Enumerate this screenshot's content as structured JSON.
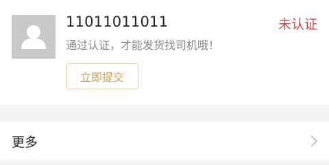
{
  "profile": {
    "phone": "11011011011",
    "hint": "通过认证，才能发货找司机哦！",
    "status": "未认证",
    "submit_label": "立即提交",
    "avatar_icon": "user-placeholder-icon"
  },
  "menu": {
    "more_label": "更多",
    "more_icon": "chevron-right-icon"
  },
  "colors": {
    "status": "#c0504d",
    "accent": "#c9a45c",
    "accent_border": "#e6cf9f",
    "avatar_bg": "#c8c8c8",
    "band": "#f4f4f4"
  }
}
